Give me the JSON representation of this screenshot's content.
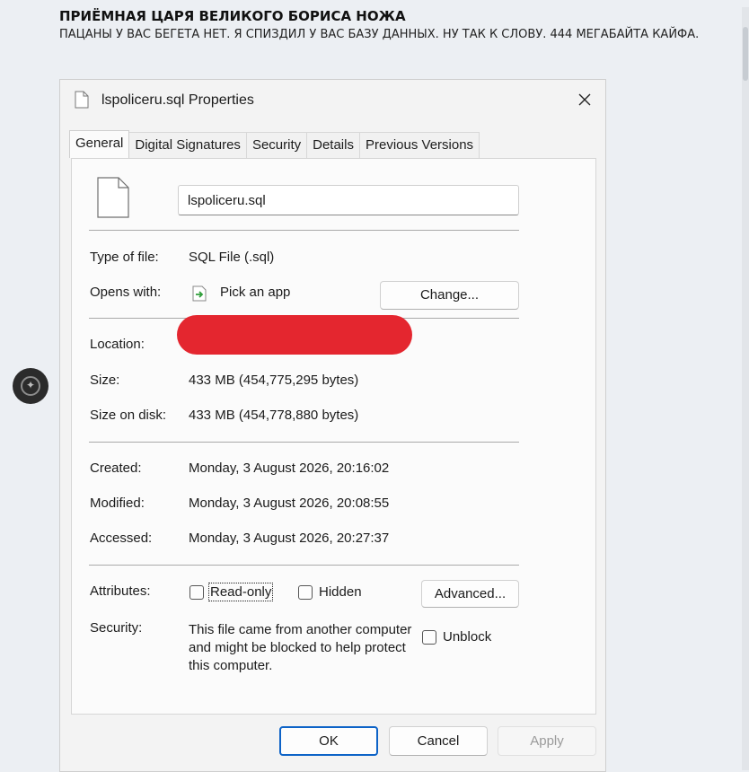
{
  "post": {
    "title": "ПРИЁМНАЯ ЦАРЯ ВЕЛИКОГО БОРИСА НОЖА",
    "body": "ПАЦАНЫ У ВАС БЕГЕТА НЕТ. Я СПИЗДИЛ У ВАС БАЗУ ДАННЫХ. НУ ТАК К СЛОВУ. 444 МЕГАБАЙТА КАЙФА."
  },
  "dialog": {
    "title": "lspoliceru.sql Properties",
    "close_icon": "close-icon",
    "tabs": [
      {
        "label": "General",
        "active": true
      },
      {
        "label": "Digital Signatures",
        "active": false
      },
      {
        "label": "Security",
        "active": false
      },
      {
        "label": "Details",
        "active": false
      },
      {
        "label": "Previous Versions",
        "active": false
      }
    ],
    "file_name": "lspoliceru.sql",
    "type_of_file": {
      "label": "Type of file:",
      "value": "SQL File (.sql)"
    },
    "opens_with": {
      "label": "Opens with:",
      "value": "Pick an app",
      "change_button": "Change..."
    },
    "location": {
      "label": "Location:",
      "value_redacted": true
    },
    "size": {
      "label": "Size:",
      "value": "433 MB (454,775,295 bytes)"
    },
    "size_on_disk": {
      "label": "Size on disk:",
      "value": "433 MB (454,778,880 bytes)"
    },
    "created": {
      "label": "Created:",
      "value": "Monday, 3 August 2026, 20:16:02"
    },
    "modified": {
      "label": "Modified:",
      "value": "Monday, 3 August 2026, 20:08:55"
    },
    "accessed": {
      "label": "Accessed:",
      "value": "Monday, 3 August 2026, 20:27:37"
    },
    "attributes": {
      "label": "Attributes:",
      "read_only": {
        "label": "Read-only",
        "checked": false
      },
      "hidden": {
        "label": "Hidden",
        "checked": false
      },
      "advanced_button": "Advanced..."
    },
    "security": {
      "label": "Security:",
      "text": "This file came from another computer and might be blocked to help protect this computer.",
      "unblock": {
        "label": "Unblock",
        "checked": false
      }
    },
    "buttons": {
      "ok": "OK",
      "cancel": "Cancel",
      "apply": "Apply"
    }
  },
  "colors": {
    "primary_button_border": "#0d63c7",
    "redaction": "#e4262f",
    "accent": "#0d63c7"
  }
}
